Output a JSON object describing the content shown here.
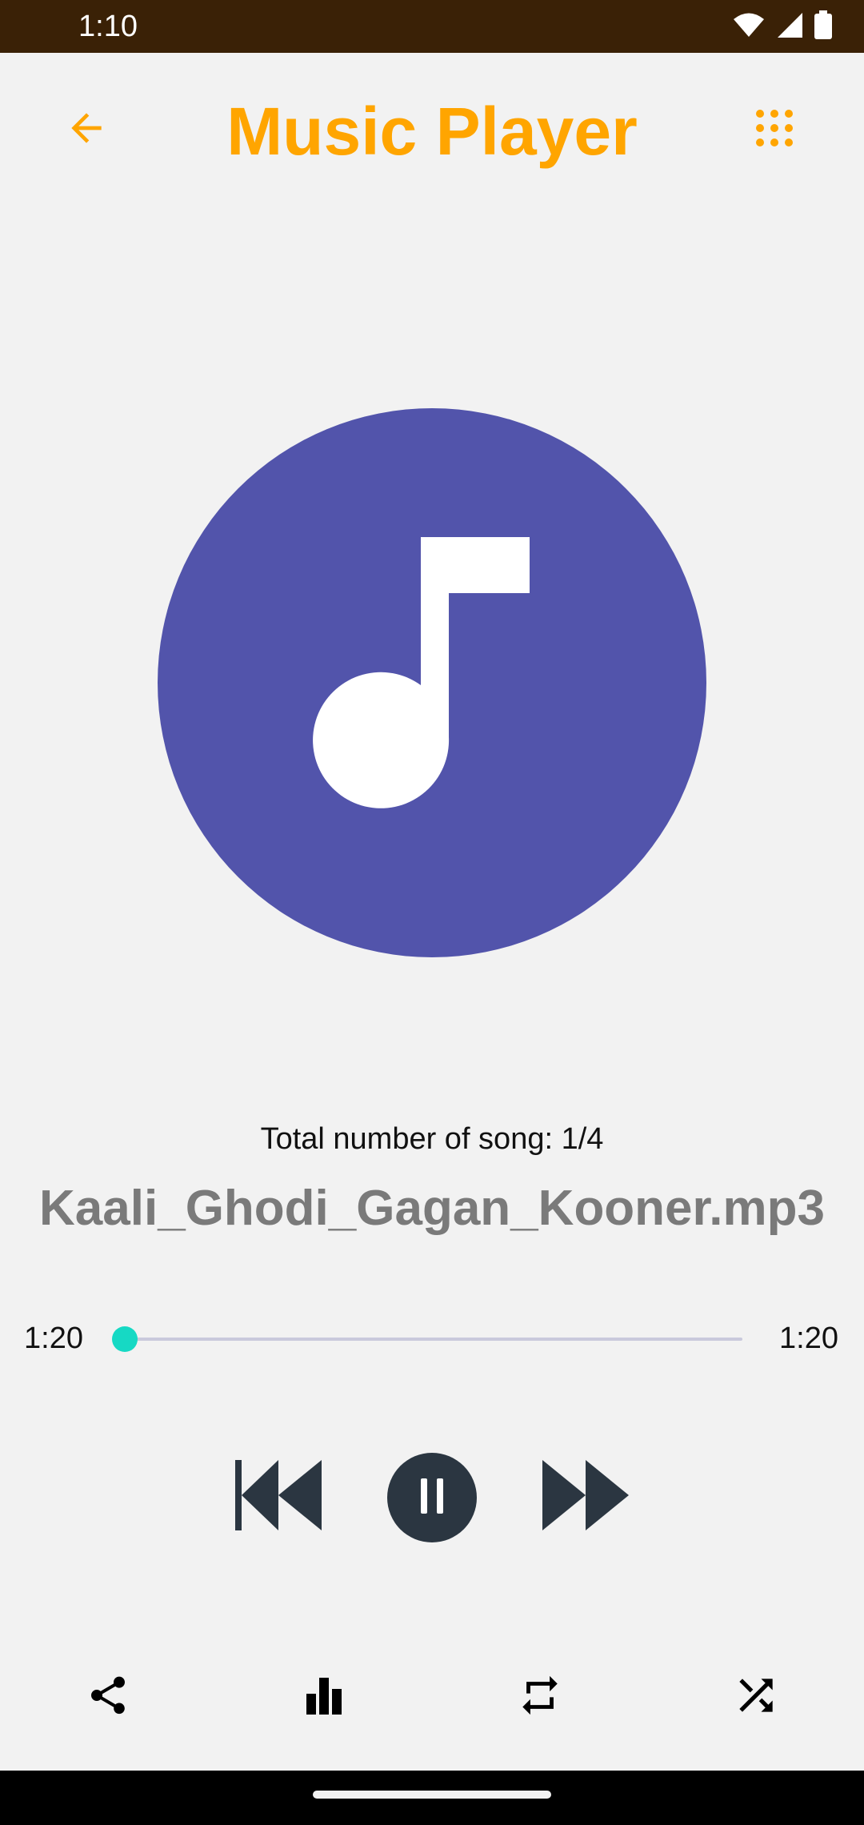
{
  "status_bar": {
    "time": "1:10",
    "icons": [
      "wifi-icon",
      "signal-icon",
      "battery-icon"
    ]
  },
  "app_bar": {
    "title": "Music Player",
    "back_icon": "arrow-back-icon",
    "menu_icon": "grid-menu-icon"
  },
  "album_art": {
    "icon": "music-note-icon",
    "background": "#5254ab"
  },
  "track_info": {
    "count_text": "Total number of song: 1/4",
    "song_name": "Kaali_Ghodi_Gagan_Kooner.mp3"
  },
  "seek": {
    "elapsed": "1:20",
    "duration": "1:20",
    "progress": 0.0
  },
  "controls": {
    "previous_icon": "skip-previous-icon",
    "play_pause_icon": "pause-icon",
    "next_icon": "skip-next-icon"
  },
  "bottom_bar": {
    "icons": [
      "share-icon",
      "equalizer-icon",
      "repeat-icon",
      "shuffle-icon"
    ]
  },
  "colors": {
    "accent": "#ffa500",
    "status_bar": "#3a2106",
    "seek_thumb": "#16d9c4",
    "control_dark": "#2b3641",
    "background": "#f2f2f2"
  }
}
